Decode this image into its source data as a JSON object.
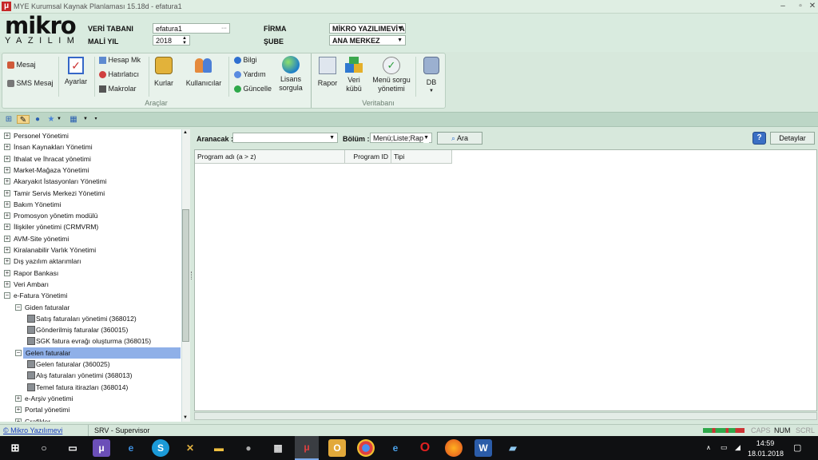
{
  "window": {
    "title": "MYE Kurumsal Kaynak Planlaması 15.18d - efatura1",
    "app_icon": "μ"
  },
  "logo": {
    "top": "mikro",
    "bottom": "YAZILIM"
  },
  "header": {
    "veri_tabani_label": "VERİ TABANI",
    "veri_tabani_value": "efatura1",
    "mali_yil_label": "MALİ YIL",
    "mali_yil_value": "2018",
    "firma_label": "FİRMA",
    "firma_value": "MİKRO YAZILIMEVİ A",
    "sube_label": "ŞUBE",
    "sube_value": "ANA MERKEZ"
  },
  "ribbon": {
    "mesaj": "Mesaj",
    "sms_mesaj": "SMS Mesaj",
    "ayarlar": "Ayarlar",
    "hesap_mk": "Hesap Mk",
    "hatirlatici": "Hatırlatıcı",
    "makrolar": "Makrolar",
    "kurlar": "Kurlar",
    "kullanicilar": "Kullanıcılar",
    "bilgi": "Bilgi",
    "yardim": "Yardım",
    "guncelle": "Güncelle",
    "lisans_sorgula": [
      "Lisans",
      "sorgula"
    ],
    "araclar_group": "Araçlar",
    "rapor": "Rapor",
    "veri_kubu": [
      "Veri",
      "kübü"
    ],
    "menu_sorgu": [
      "Menü sorgu",
      "yönetimi"
    ],
    "db": "DB",
    "veritabani_group": "Veritabanı"
  },
  "tree": {
    "items": [
      {
        "label": "Personel Yönetimi",
        "level": 0,
        "kind": "plus"
      },
      {
        "label": "İnsan Kaynakları Yönetimi",
        "level": 0,
        "kind": "plus"
      },
      {
        "label": "İthalat ve İhracat yönetimi",
        "level": 0,
        "kind": "plus"
      },
      {
        "label": "Market-Mağaza Yönetimi",
        "level": 0,
        "kind": "plus"
      },
      {
        "label": "Akaryakıt İstasyonları Yönetimi",
        "level": 0,
        "kind": "plus"
      },
      {
        "label": "Tamir Servis Merkezi Yönetimi",
        "level": 0,
        "kind": "plus"
      },
      {
        "label": "Bakım Yönetimi",
        "level": 0,
        "kind": "plus"
      },
      {
        "label": "Promosyon yönetim modülü",
        "level": 0,
        "kind": "plus"
      },
      {
        "label": "İlişkiler yönetimi (CRMVRM)",
        "level": 0,
        "kind": "plus"
      },
      {
        "label": "AVM-Site yönetimi",
        "level": 0,
        "kind": "plus"
      },
      {
        "label": "Kiralanabilir Varlık Yönetimi",
        "level": 0,
        "kind": "plus"
      },
      {
        "label": "Dış yazılım aktarımları",
        "level": 0,
        "kind": "plus"
      },
      {
        "label": "Rapor Bankası",
        "level": 0,
        "kind": "plus"
      },
      {
        "label": "Veri Ambarı",
        "level": 0,
        "kind": "plus"
      },
      {
        "label": "e-Fatura Yönetimi",
        "level": 0,
        "kind": "minus"
      },
      {
        "label": "Giden faturalar",
        "level": 1,
        "kind": "minus"
      },
      {
        "label": "Satış faturaları yönetimi (368012)",
        "level": 2,
        "kind": "leaf"
      },
      {
        "label": "Gönderilmiş faturalar (360015)",
        "level": 2,
        "kind": "leaf"
      },
      {
        "label": "SGK fatura evrağı oluşturma (368015)",
        "level": 2,
        "kind": "leaf"
      },
      {
        "label": "Gelen faturalar",
        "level": 1,
        "kind": "minus",
        "selected": true
      },
      {
        "label": "Gelen faturalar (360025)",
        "level": 2,
        "kind": "leaf"
      },
      {
        "label": "Alış faturaları yönetimi (368013)",
        "level": 2,
        "kind": "leaf"
      },
      {
        "label": "Temel fatura itirazları (368014)",
        "level": 2,
        "kind": "leaf"
      },
      {
        "label": "e-Arşiv yönetimi",
        "level": 1,
        "kind": "plus"
      },
      {
        "label": "Portal yönetimi",
        "level": 1,
        "kind": "plus"
      },
      {
        "label": "Grafikler",
        "level": 1,
        "kind": "plus"
      }
    ]
  },
  "search": {
    "aranacak_label": "Aranacak :",
    "aranacak_value": "",
    "bolum_label": "Bölüm :",
    "bolum_value": "Menü;Liste;Rap",
    "ara_button": "Ara",
    "help": "?",
    "detaylar_button": "Detaylar"
  },
  "grid": {
    "columns": [
      "Program adı (a > z)",
      "Program ID",
      "Tipi"
    ]
  },
  "status": {
    "link": "© Mikro Yazılımevi",
    "user": "SRV - Supervisor",
    "caps": "CAPS",
    "num": "NUM",
    "scrl": "SCRL"
  },
  "taskbar": {
    "time": "14:59",
    "date": "18.01.2018"
  },
  "colors": {
    "selection": "#8fb0e8",
    "link": "#1a3fbf",
    "accent_red": "#c62828"
  }
}
